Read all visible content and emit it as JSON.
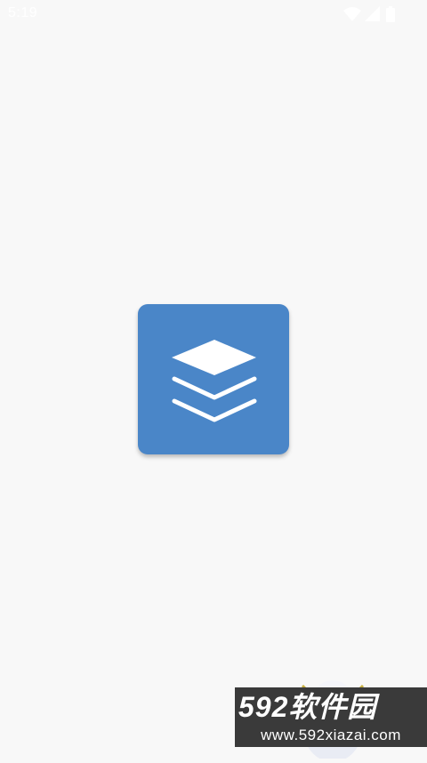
{
  "status_bar": {
    "time": "5:19",
    "icons": [
      "wifi-icon",
      "signal-icon",
      "battery-icon"
    ]
  },
  "splash": {
    "icon": "layers-icon",
    "background_color": "#4a86c8",
    "page_color": "#f8f8f8"
  },
  "watermark": {
    "title": "592软件园",
    "url": "www.592xiazai.com"
  }
}
